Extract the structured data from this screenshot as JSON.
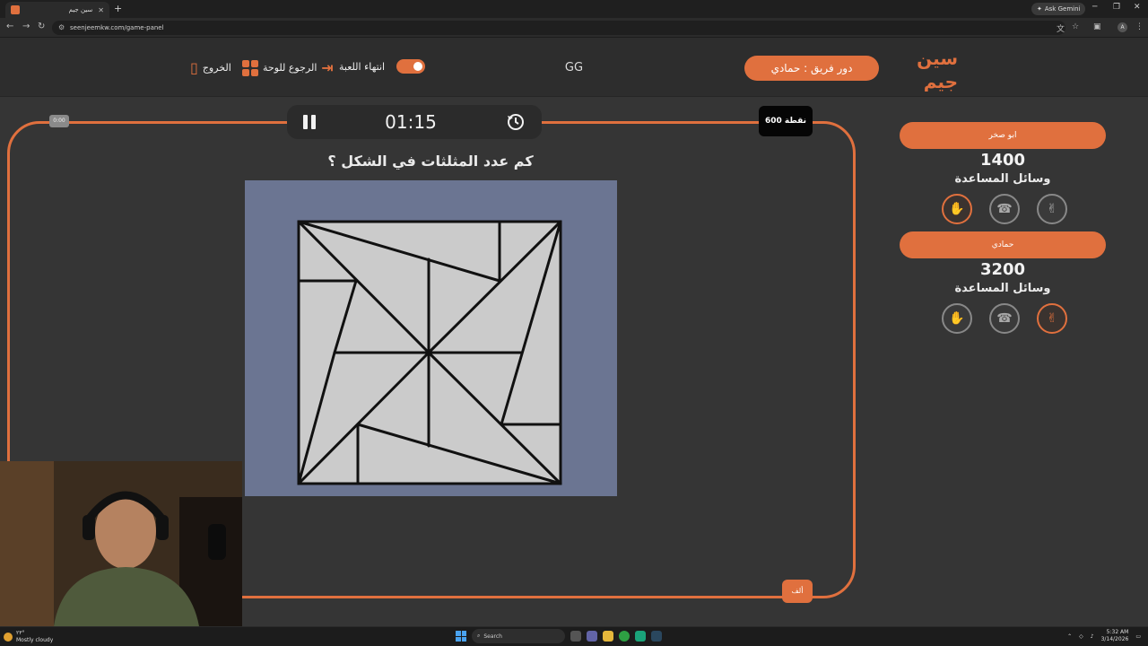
{
  "browser": {
    "tab_title": "سين جيم",
    "tab_close": "✕",
    "new_tab": "+",
    "url": "seenjeemkw.com/game-panel",
    "gemini_label": "Ask Gemini",
    "avatar_letter": "A"
  },
  "header": {
    "logo_text_top": "سين",
    "logo_text_bottom": "جيم",
    "turn_label": "دور فريق : حمادي",
    "center_text": "GG",
    "end_game": "انتهاء اللعبة",
    "back_to_board": "الرجوع للوحة",
    "exit": "الخروج"
  },
  "game": {
    "timer": "01:15",
    "points": "600 نقطة",
    "question": "كم عدد المثلثات في الشكل ؟",
    "left_tag": "0:00",
    "answer_button": "ألف"
  },
  "teams": [
    {
      "name": "ابو صخر",
      "score": "1400",
      "aids_label": "وسائل المساعدة",
      "aids": [
        {
          "icon": "hand-icon",
          "active": true
        },
        {
          "icon": "phone-icon",
          "active": false
        },
        {
          "icon": "peace-icon",
          "active": false
        }
      ]
    },
    {
      "name": "حمادي",
      "score": "3200",
      "aids_label": "وسائل المساعدة",
      "aids": [
        {
          "icon": "hand-icon",
          "active": false
        },
        {
          "icon": "phone-icon",
          "active": false
        },
        {
          "icon": "peace-icon",
          "active": true
        }
      ]
    }
  ],
  "taskbar": {
    "temp": "٢٣°",
    "weather": "Mostly cloudy",
    "search": "Search",
    "time": "5:32 AM",
    "date": "3/14/2026"
  },
  "colors": {
    "accent": "#e0703e",
    "puzzle_bg": "#6b7592",
    "puzzle_fill": "#cbcbcb"
  }
}
